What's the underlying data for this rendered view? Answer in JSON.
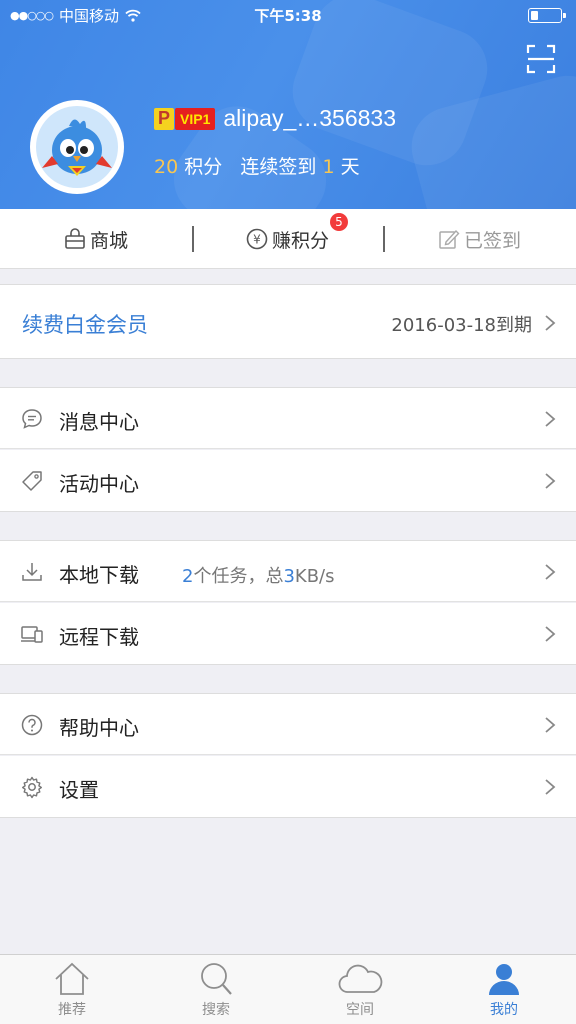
{
  "status_bar": {
    "signal_dots": "●●○○○",
    "carrier": "中国移动",
    "time": "下午5:38",
    "battery_level": 0.25
  },
  "profile": {
    "p_badge": "P",
    "vip_label": "VIP1",
    "username": "alipay_…356833",
    "points": "20",
    "points_label": "积分",
    "streak_prefix": "连续签到",
    "streak_days": "1",
    "streak_suffix": "天"
  },
  "quick_actions": {
    "mall": "商城",
    "earn_points": "赚积分",
    "earn_points_badge": "5",
    "signed_in": "已签到"
  },
  "renew": {
    "label": "续费白金会员",
    "expiry": "2016-03-18到期"
  },
  "menu": {
    "messages": "消息中心",
    "activities": "活动中心",
    "local_download": "本地下载",
    "download_tasks": "2",
    "download_tasks_suffix": "个任务，总",
    "download_speed": "3",
    "download_speed_unit": "KB/s",
    "remote_download": "远程下载",
    "help": "帮助中心",
    "settings": "设置"
  },
  "tabs": [
    {
      "label": "推荐",
      "icon": "home-icon"
    },
    {
      "label": "搜索",
      "icon": "search-icon"
    },
    {
      "label": "空间",
      "icon": "cloud-icon"
    },
    {
      "label": "我的",
      "icon": "person-icon"
    }
  ],
  "colors": {
    "header_blue": "#4a90ea",
    "accent_blue": "#3a7fd5",
    "points_orange": "#f7c653",
    "badge_red": "#f23b3b"
  }
}
